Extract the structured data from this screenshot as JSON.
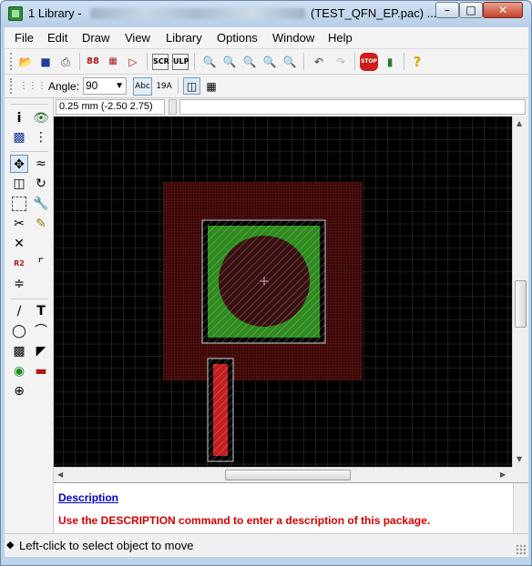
{
  "window": {
    "title_prefix": "1 Library - ",
    "title_suffix": "(TEST_QFN_EP.pac) ...",
    "buttons": {
      "minimize": "–",
      "maximize": "□",
      "close": "✕"
    }
  },
  "menubar": {
    "items": [
      {
        "label": "File"
      },
      {
        "label": "Edit"
      },
      {
        "label": "Draw"
      },
      {
        "label": "View"
      },
      {
        "label": "Library"
      },
      {
        "label": "Options"
      },
      {
        "label": "Window"
      },
      {
        "label": "Help"
      }
    ]
  },
  "toolbar": {
    "angle_label": "Angle:",
    "angle_value": "90"
  },
  "coordbar": {
    "coordinates": "0.25 mm (-2.50 2.75)"
  },
  "canvas": {
    "background": "#000000",
    "grid_color": "#3a3a3a",
    "keepout_color": "#8a1c1c",
    "copper_color": "#2e8b1e",
    "pad_color": "#c41e1e"
  },
  "description": {
    "heading": "Description",
    "message": "Use the DESCRIPTION command to enter a description of this package."
  },
  "status": {
    "text": "Left-click to select object to move"
  }
}
